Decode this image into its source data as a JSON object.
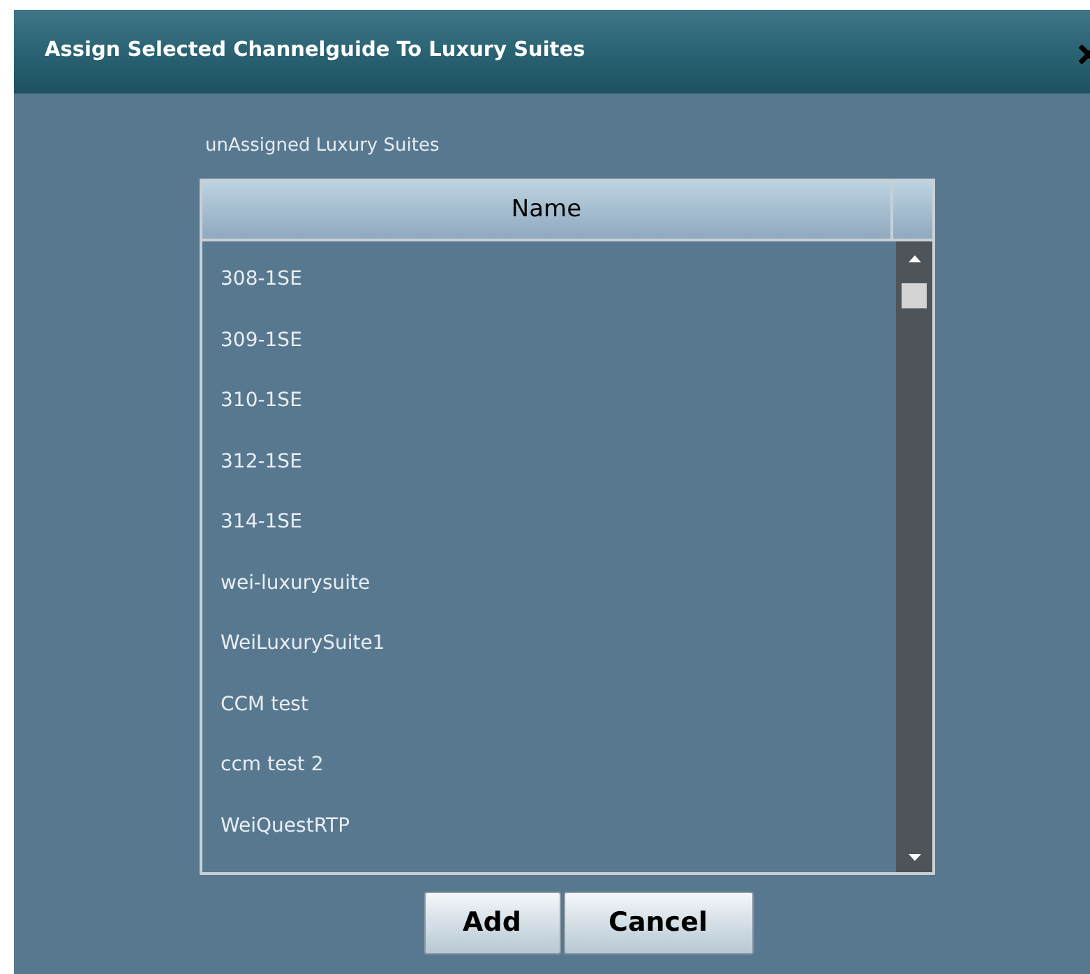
{
  "window": {
    "title": "Assign Selected Channelguide To Luxury Suites"
  },
  "list_label": "unAssigned Luxury Suites",
  "table": {
    "columns": [
      "Name"
    ],
    "rows": [
      "308-1SE",
      "309-1SE",
      "310-1SE",
      "312-1SE",
      "314-1SE",
      "wei-luxurysuite",
      "WeiLuxurySuite1",
      "CCM test",
      "ccm test 2",
      "WeiQuestRTP"
    ]
  },
  "buttons": [
    "Add",
    "Cancel"
  ]
}
